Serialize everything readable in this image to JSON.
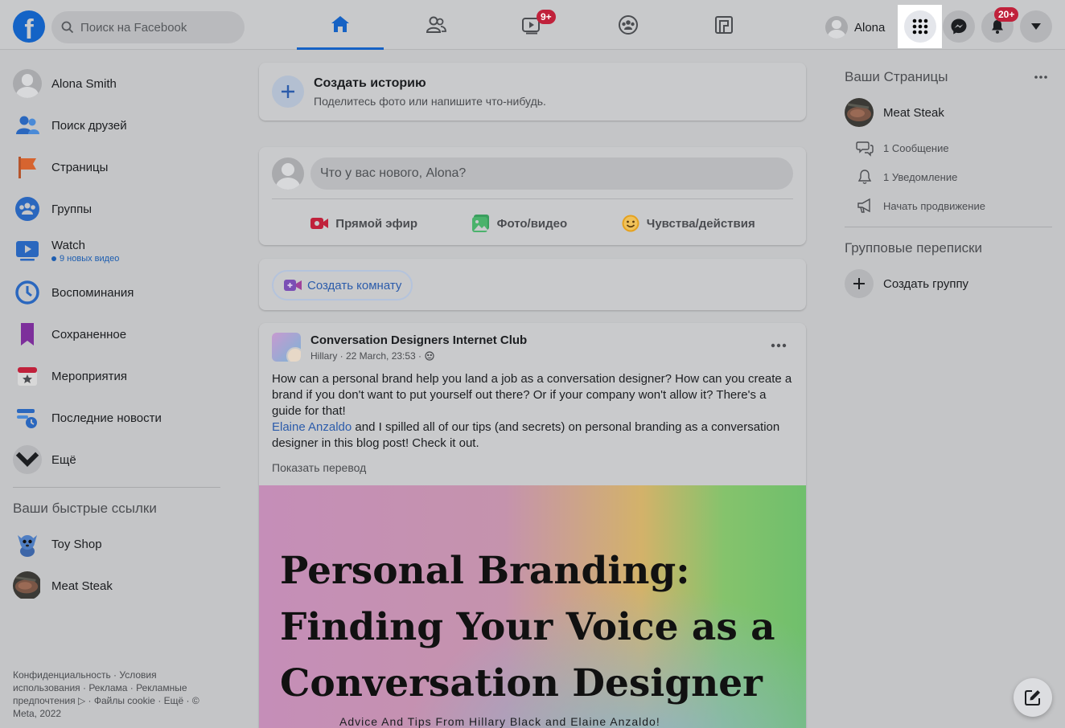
{
  "topbar": {
    "logo_letter": "f",
    "search_placeholder": "Поиск на Facebook",
    "watch_badge": "9+",
    "profile_name": "Alona",
    "notifications_badge": "20+"
  },
  "left_nav": {
    "items": [
      {
        "label": "Alona Smith"
      },
      {
        "label": "Поиск друзей"
      },
      {
        "label": "Страницы"
      },
      {
        "label": "Группы"
      },
      {
        "label": "Watch",
        "sub": "9 новых видео"
      },
      {
        "label": "Воспоминания"
      },
      {
        "label": "Сохраненное"
      },
      {
        "label": "Мероприятия"
      },
      {
        "label": "Последние новости"
      },
      {
        "label": "Ещё"
      }
    ],
    "shortcuts_heading": "Ваши быстрые ссылки",
    "shortcuts": [
      {
        "label": "Toy Shop"
      },
      {
        "label": "Meat Steak"
      }
    ],
    "footer": "Конфиденциальность · Условия использования · Реклама · Рекламные предпочтения ▷ · Файлы cookie · Ещё · © Meta, 2022"
  },
  "story": {
    "title": "Создать историю",
    "subtitle": "Поделитесь фото или напишите что-нибудь."
  },
  "composer": {
    "placeholder": "Что у вас нового, Alona?",
    "actions": [
      "Прямой эфир",
      "Фото/видео",
      "Чувства/действия"
    ]
  },
  "room": {
    "label": "Создать комнату"
  },
  "post": {
    "group": "Conversation Designers Internet Club",
    "author_meta": "Hillary · 22 March, 23:53 ·",
    "text_1": "How can a personal brand help you land a job as a conversation designer? How can you create a brand if you don't want to put yourself out there? Or if your company won't allow it? There's a guide for that!",
    "mention": "Elaine Anzaldo",
    "text_2": " and I spilled all of our tips (and secrets) on personal branding as a conversation designer in this blog post! Check it out.",
    "translate": "Показать перевод",
    "image_title_lines": [
      "Personal Branding:",
      "Finding Your Voice as a",
      "Conversation Designer"
    ],
    "image_subtitle": "Advice And Tips From Hillary Black and Elaine Anzaldo!"
  },
  "right": {
    "pages_heading": "Ваши Страницы",
    "page_name": "Meat Steak",
    "page_subitems": [
      "1 Сообщение",
      "1 Уведомление",
      "Начать продвижение"
    ],
    "group_chats_heading": "Групповые переписки",
    "create_group": "Создать группу"
  },
  "colors": {
    "brand_blue": "#1463c6",
    "badge_red": "#c0213b",
    "link_blue": "#2c5cab"
  }
}
